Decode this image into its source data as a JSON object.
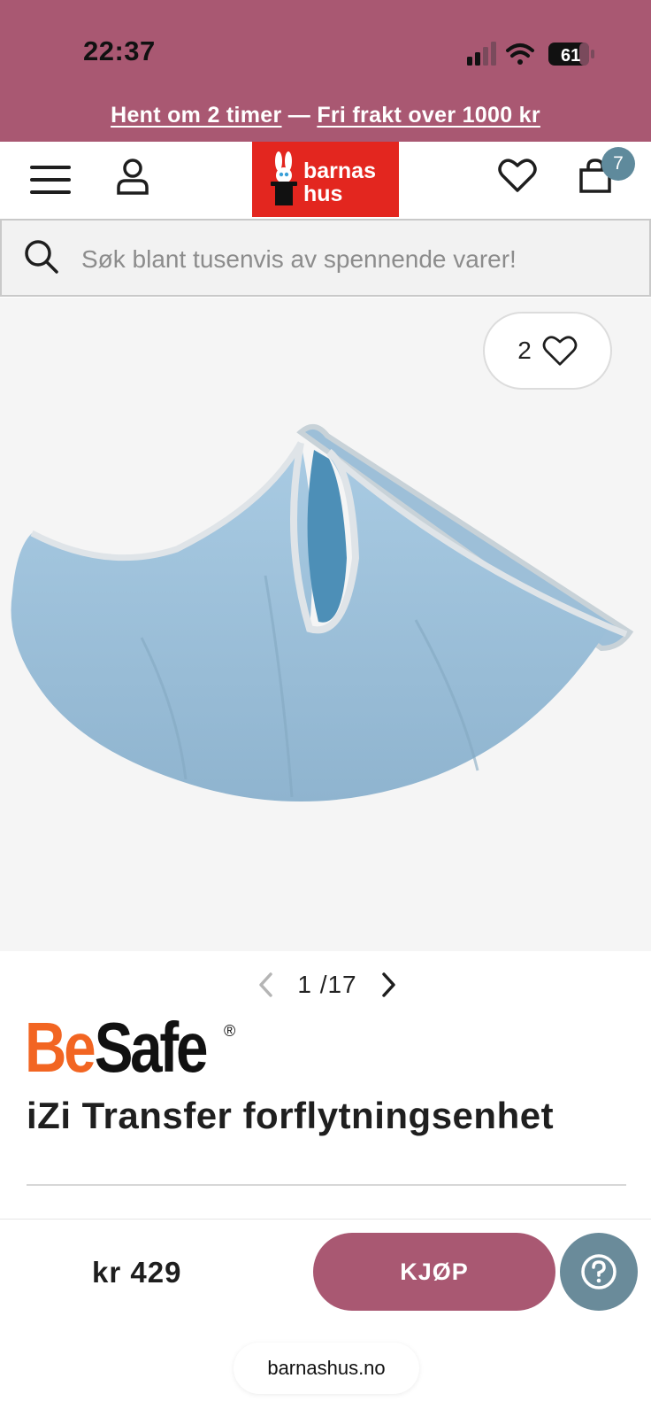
{
  "status_bar": {
    "time": "22:37",
    "battery": "61"
  },
  "promo": {
    "part1": "Hent om 2 timer",
    "separator": " — ",
    "part2": "Fri frakt over 1000 kr"
  },
  "header": {
    "logo_line1": "barnas",
    "logo_line2": "hus",
    "cart_count": "7",
    "icons": [
      "menu-icon",
      "account-icon",
      "heart-icon",
      "cart-icon"
    ]
  },
  "search": {
    "placeholder": "Søk blant tusenvis av spennende varer!"
  },
  "product": {
    "like_count": "2",
    "pager_current": "1",
    "pager_separator": "/",
    "pager_total": "17",
    "brand_part1": "Be",
    "brand_part2": "Safe",
    "brand_mark": "®",
    "title": "iZi Transfer forflytningsenhet",
    "price": "kr 429",
    "buy_label": "KJØP"
  },
  "browser": {
    "url": "barnashus.no"
  },
  "colors": {
    "brand_pink": "#a95872",
    "logo_red": "#e3261f",
    "help_blue": "#6a8b9a",
    "badge_blue": "#5f8a9c",
    "besafe_orange": "#f26522"
  }
}
